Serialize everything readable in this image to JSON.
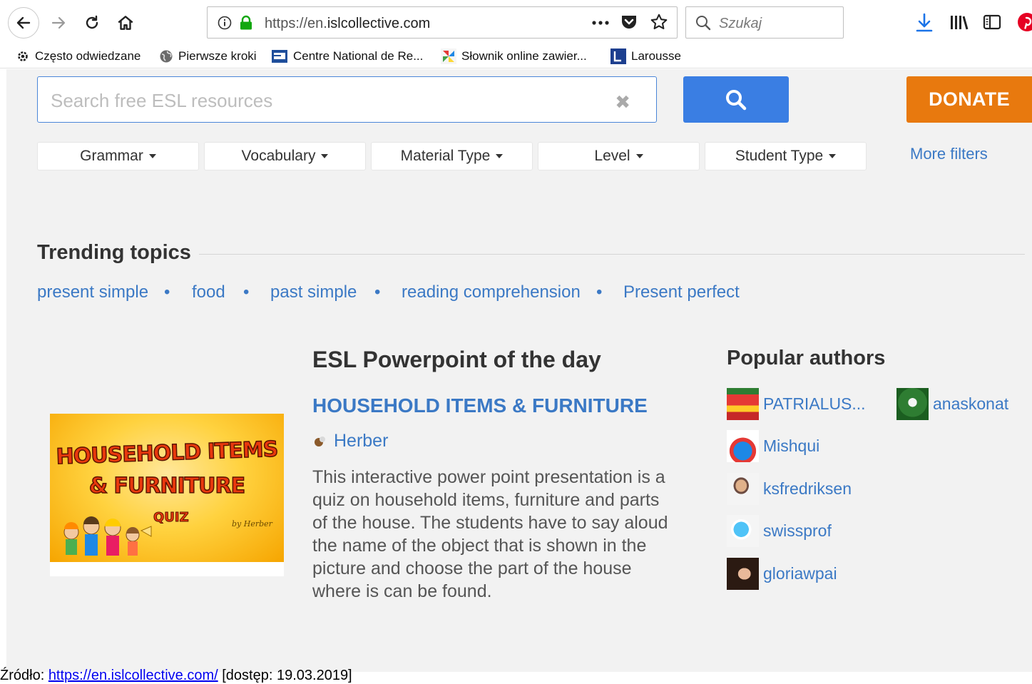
{
  "browser": {
    "url_prefix": "https://en.",
    "url_domain": "islcollective.com",
    "search_placeholder": "Szukaj",
    "bookmarks": [
      {
        "label": "Często odwiedzane",
        "icon": "gear-icon"
      },
      {
        "label": "Pierwsze kroki",
        "icon": "globe-icon"
      },
      {
        "label": "Centre National de Re...",
        "icon": "cnrtl-icon"
      },
      {
        "label": "Słownik online zawier...",
        "icon": "pinwheel-icon"
      },
      {
        "label": "Larousse",
        "icon": "larousse-icon"
      }
    ],
    "colors": {
      "accent": "#1a73e8",
      "pinterest": "#e60023"
    }
  },
  "site": {
    "search_placeholder": "Search free ESL resources",
    "donate_label": "DONATE",
    "filters": [
      "Grammar",
      "Vocabulary",
      "Material Type",
      "Level",
      "Student Type"
    ],
    "more_filters": "More filters",
    "colors": {
      "link": "#3b79c5",
      "search_button": "#3a7ee3",
      "donate": "#e8790e"
    }
  },
  "trending": {
    "title": "Trending topics",
    "separator": "•",
    "topics": [
      "present simple",
      "food",
      "past simple",
      "reading comprehension",
      "Present perfect"
    ]
  },
  "ppt_of_day": {
    "heading": "ESL Powerpoint of the day",
    "title": "HOUSEHOLD ITEMS & FURNITURE",
    "author": "Herber",
    "description": "This interactive power point presentation is a quiz on household items, furniture and parts of the house. The students have to say aloud the name of the object that is shown in the picture and choose the part of the house where is can be found.",
    "thumbnail": {
      "line1": "HOUSEHOLD ITEMS",
      "line2": "& FURNITURE",
      "line3": "QUIZ",
      "byline": "by Herber"
    }
  },
  "popular_authors": {
    "heading": "Popular authors",
    "authors": [
      "PATRIALUS...",
      "anaskonat",
      "Mishqui",
      "ksfredriksen",
      "swissprof",
      "gloriawpai"
    ]
  },
  "caption": {
    "prefix": "Źródło: ",
    "link": "https://en.islcollective.com/",
    "suffix": " [dostęp: 19.03.2019]"
  }
}
